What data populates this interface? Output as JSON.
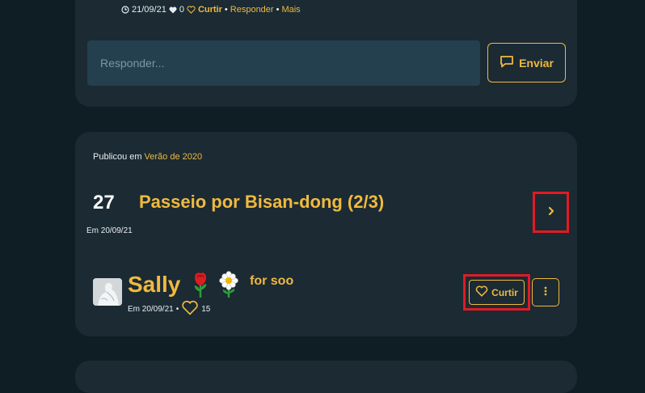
{
  "top_comment": {
    "date": "21/09/21",
    "likes": "0",
    "like_label": "Curtir",
    "sep1": "•",
    "reply_label": "Responder",
    "sep2": "•",
    "more_label": "Mais"
  },
  "reply_box": {
    "placeholder": "Responder...",
    "send_label": "Enviar"
  },
  "post": {
    "published_prefix": "Publicou em",
    "published_link": "Verão de 2020",
    "number": "27",
    "title": "Passeio por Bisan-dong (2/3)",
    "date": "Em 20/09/21",
    "next_icon": "chevron-right-icon"
  },
  "comment": {
    "author": "Sally",
    "author_suffix": "for soo",
    "date": "Em 20/09/21",
    "sep": "•",
    "likes": "15",
    "like_label": "Curtir",
    "more_icon": "vertical-dots-icon"
  },
  "colors": {
    "background": "#0f1d24",
    "card": "#1b2a33",
    "accent": "#f0b93f",
    "input": "#24404f",
    "highlight": "#e01b24"
  }
}
